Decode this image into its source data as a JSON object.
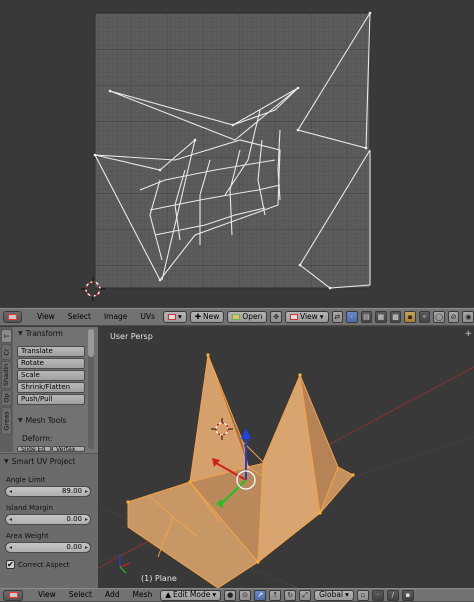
{
  "uv_editor": {
    "header": {
      "menus": [
        "View",
        "Select",
        "Image",
        "UVs"
      ],
      "new_label": "New",
      "open_label": "Open",
      "view_label": "View"
    }
  },
  "tool_shelf": {
    "tabs": [
      "T",
      "Cr",
      "Shadin",
      "Op",
      "Greas"
    ],
    "transform_title": "Transform",
    "transform_buttons": [
      "Translate",
      "Rotate",
      "Scale",
      "Shrink/Flatten",
      "Push/Pull"
    ],
    "mesh_tools_title": "Mesh Tools",
    "deform_label": "Deform:",
    "deform_buttons": [
      "Slide Ed",
      "Vertex"
    ]
  },
  "operator_panel": {
    "title": "Smart UV Project",
    "angle_limit_label": "Angle Limit",
    "angle_limit_value": "89.00",
    "island_margin_label": "Island Margin",
    "island_margin_value": "0.00",
    "area_weight_label": "Area Weight",
    "area_weight_value": "0.00",
    "correct_aspect_label": "Correct Aspect",
    "correct_aspect_checked": true
  },
  "viewport": {
    "view_label": "User Persp",
    "object_label": "(1) Plane"
  },
  "view3d_header": {
    "menus": [
      "View",
      "Select",
      "Add",
      "Mesh"
    ],
    "mode_label": "Edit Mode",
    "orientation_label": "Global"
  },
  "colors": {
    "uv_bg": "#5a5a5a",
    "mesh_fill": "#c8935a",
    "mesh_edge": "#f5a12a",
    "axis_x": "#d02020",
    "axis_y": "#20c020",
    "axis_z": "#2040e0"
  }
}
